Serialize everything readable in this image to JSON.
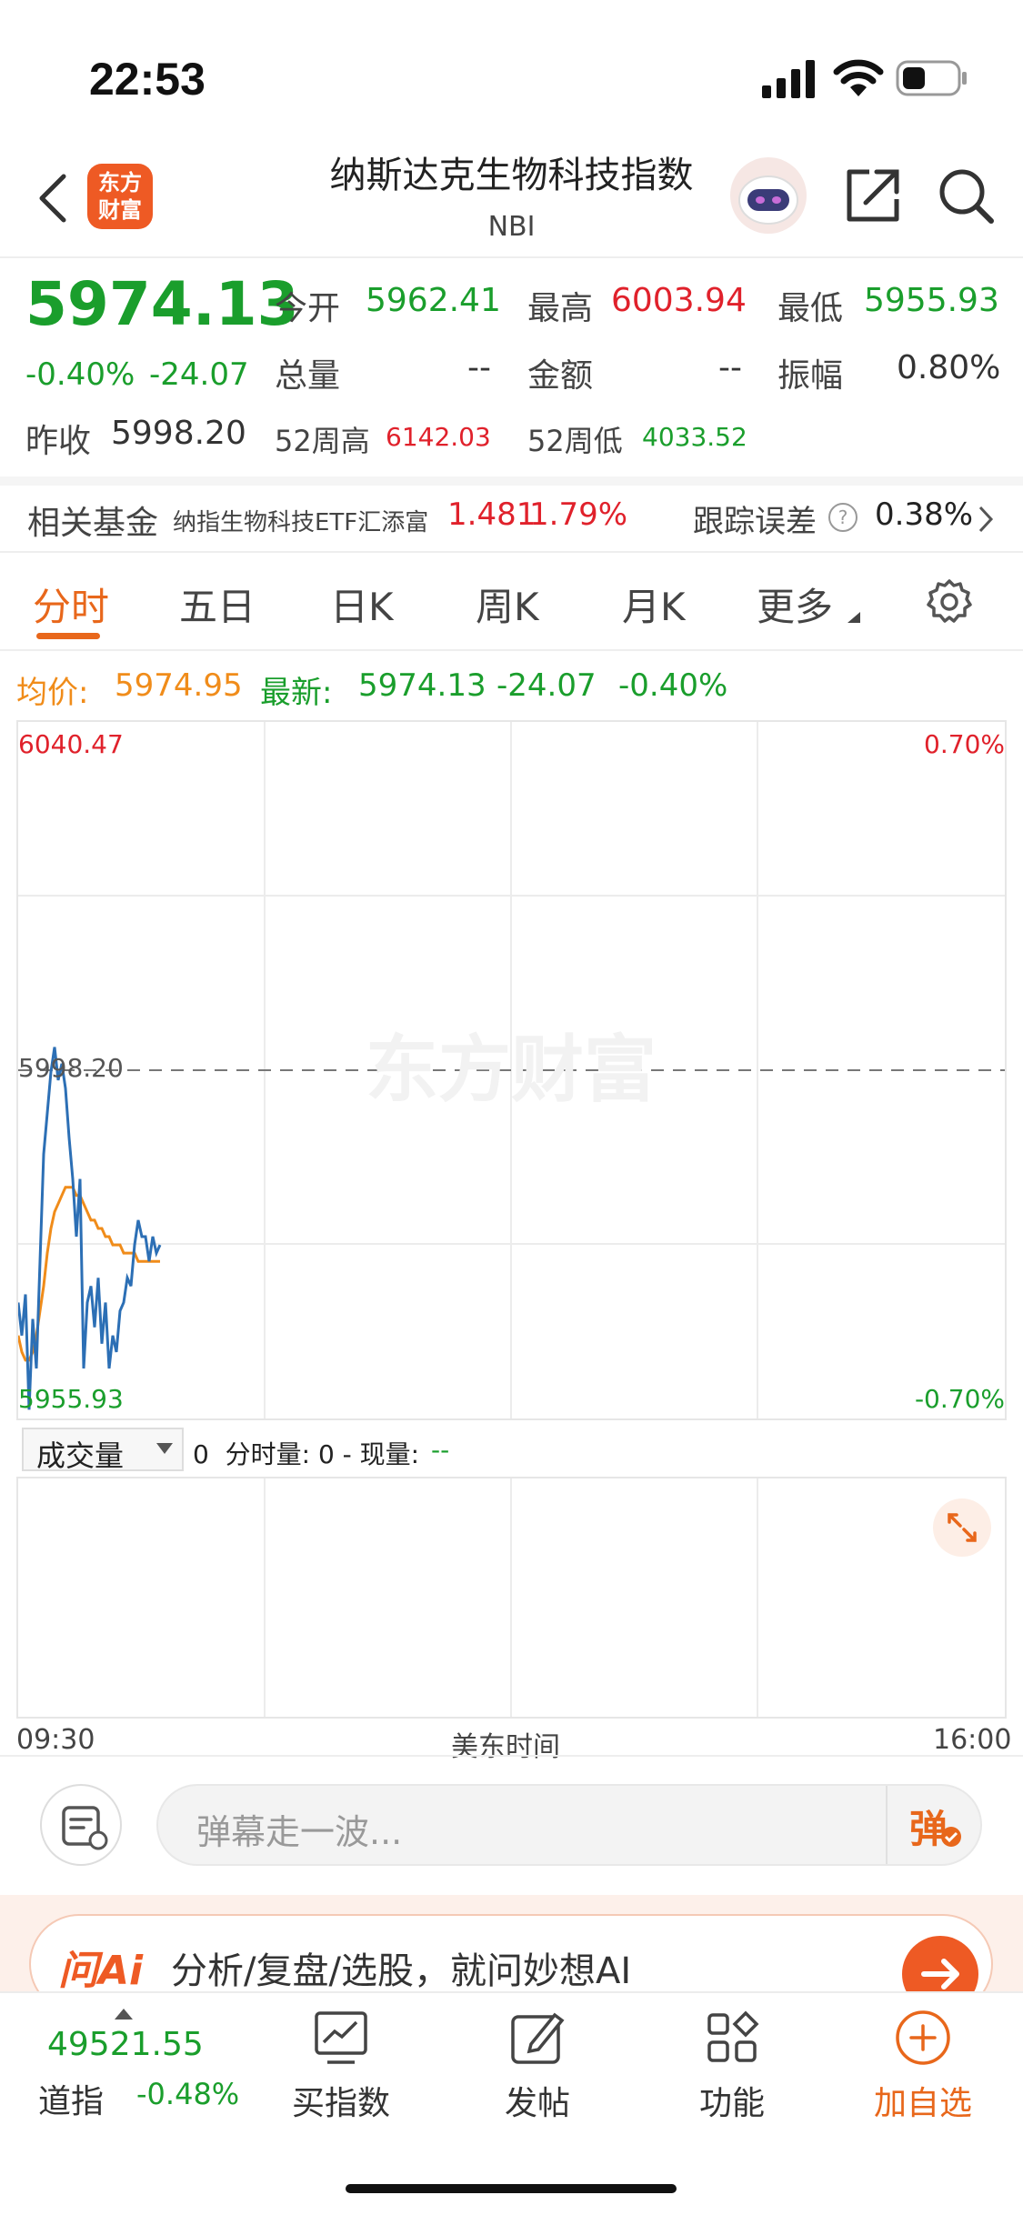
{
  "status_bar": {
    "time": "22:53"
  },
  "header": {
    "logo_text": "东方\n财富",
    "title": "纳斯达克生物科技指数",
    "code": "NBI"
  },
  "quote": {
    "price": "5974.13",
    "change_pct": "-0.40%",
    "change": "-24.07",
    "open_label": "今开",
    "open": "5962.41",
    "high_label": "最高",
    "high": "6003.94",
    "low_label": "最低",
    "low": "5955.93",
    "volume_label": "总量",
    "volume": "--",
    "amount_label": "金额",
    "amount": "--",
    "amplitude_label": "振幅",
    "amplitude": "0.80%",
    "prev_close_label": "昨收",
    "prev_close": "5998.20",
    "wk52_high_label": "52周高",
    "wk52_high": "6142.03",
    "wk52_low_label": "52周低",
    "wk52_low": "4033.52"
  },
  "fund": {
    "label": "相关基金",
    "name": "纳指生物科技ETF汇添富",
    "price": "1.481",
    "pct": "1.79%",
    "tracking_label": "跟踪误差",
    "tracking_value": "0.38%"
  },
  "tabs": [
    "分时",
    "五日",
    "日K",
    "周K",
    "月K",
    "更多"
  ],
  "chart_info": {
    "avg_label": "均价:",
    "avg_value": "5974.95",
    "latest_label": "最新:",
    "latest_value": "5974.13",
    "latest_change": "-24.07",
    "latest_pct": "-0.40%"
  },
  "chart_data": {
    "type": "line",
    "y_top": "6040.47",
    "y_mid": "5998.20",
    "y_bottom": "5955.93",
    "pct_top": "0.70%",
    "pct_bottom": "-0.70%",
    "ylim": [
      5955.93,
      6040.47
    ],
    "watermark": "东方财富",
    "series": [
      {
        "name": "最新",
        "values": [
          5970,
          5966,
          5971,
          5957,
          5968,
          5962,
          5975,
          5988,
          5993,
          5998,
          6001,
          5997,
          5999,
          5996,
          5990,
          5985,
          5978,
          5985,
          5962,
          5970,
          5972,
          5967,
          5973,
          5965,
          5970,
          5962,
          5966,
          5964,
          5969,
          5970,
          5973,
          5972,
          5977,
          5980,
          5978,
          5978,
          5975,
          5978,
          5976,
          5977
        ]
      },
      {
        "name": "均价",
        "values": [
          5966,
          5964,
          5963,
          5963,
          5964,
          5966,
          5969,
          5972,
          5976,
          5979,
          5981,
          5982,
          5983,
          5984,
          5984,
          5984,
          5983,
          5983,
          5982,
          5981,
          5980,
          5980,
          5979,
          5979,
          5978,
          5978,
          5977,
          5977,
          5977,
          5976,
          5976,
          5976,
          5976,
          5975,
          5975,
          5975,
          5975,
          5975,
          5975,
          5975
        ]
      }
    ]
  },
  "volume_panel": {
    "selector": "成交量",
    "stats": "0  分时量: 0 - 现量:",
    "current": "--"
  },
  "time_axis": {
    "start": "09:30",
    "middle": "美东时间",
    "end": "16:00"
  },
  "danmu": {
    "placeholder": "弹幕走一波...",
    "send_label": "弹"
  },
  "ai_banner": {
    "brand": "问Ai",
    "text": "分析/复盘/选股，就问妙想AI"
  },
  "bottom_nav": {
    "index_value": "49521.55",
    "index_name": "道指",
    "index_pct": "-0.48%",
    "items": [
      "买指数",
      "发帖",
      "功能",
      "加自选"
    ]
  },
  "colors": {
    "up": "#e0212b",
    "down": "#1a9e2c",
    "accent": "#e8671b",
    "price_line": "#2c6fb5",
    "avg_line": "#f08c1a"
  }
}
